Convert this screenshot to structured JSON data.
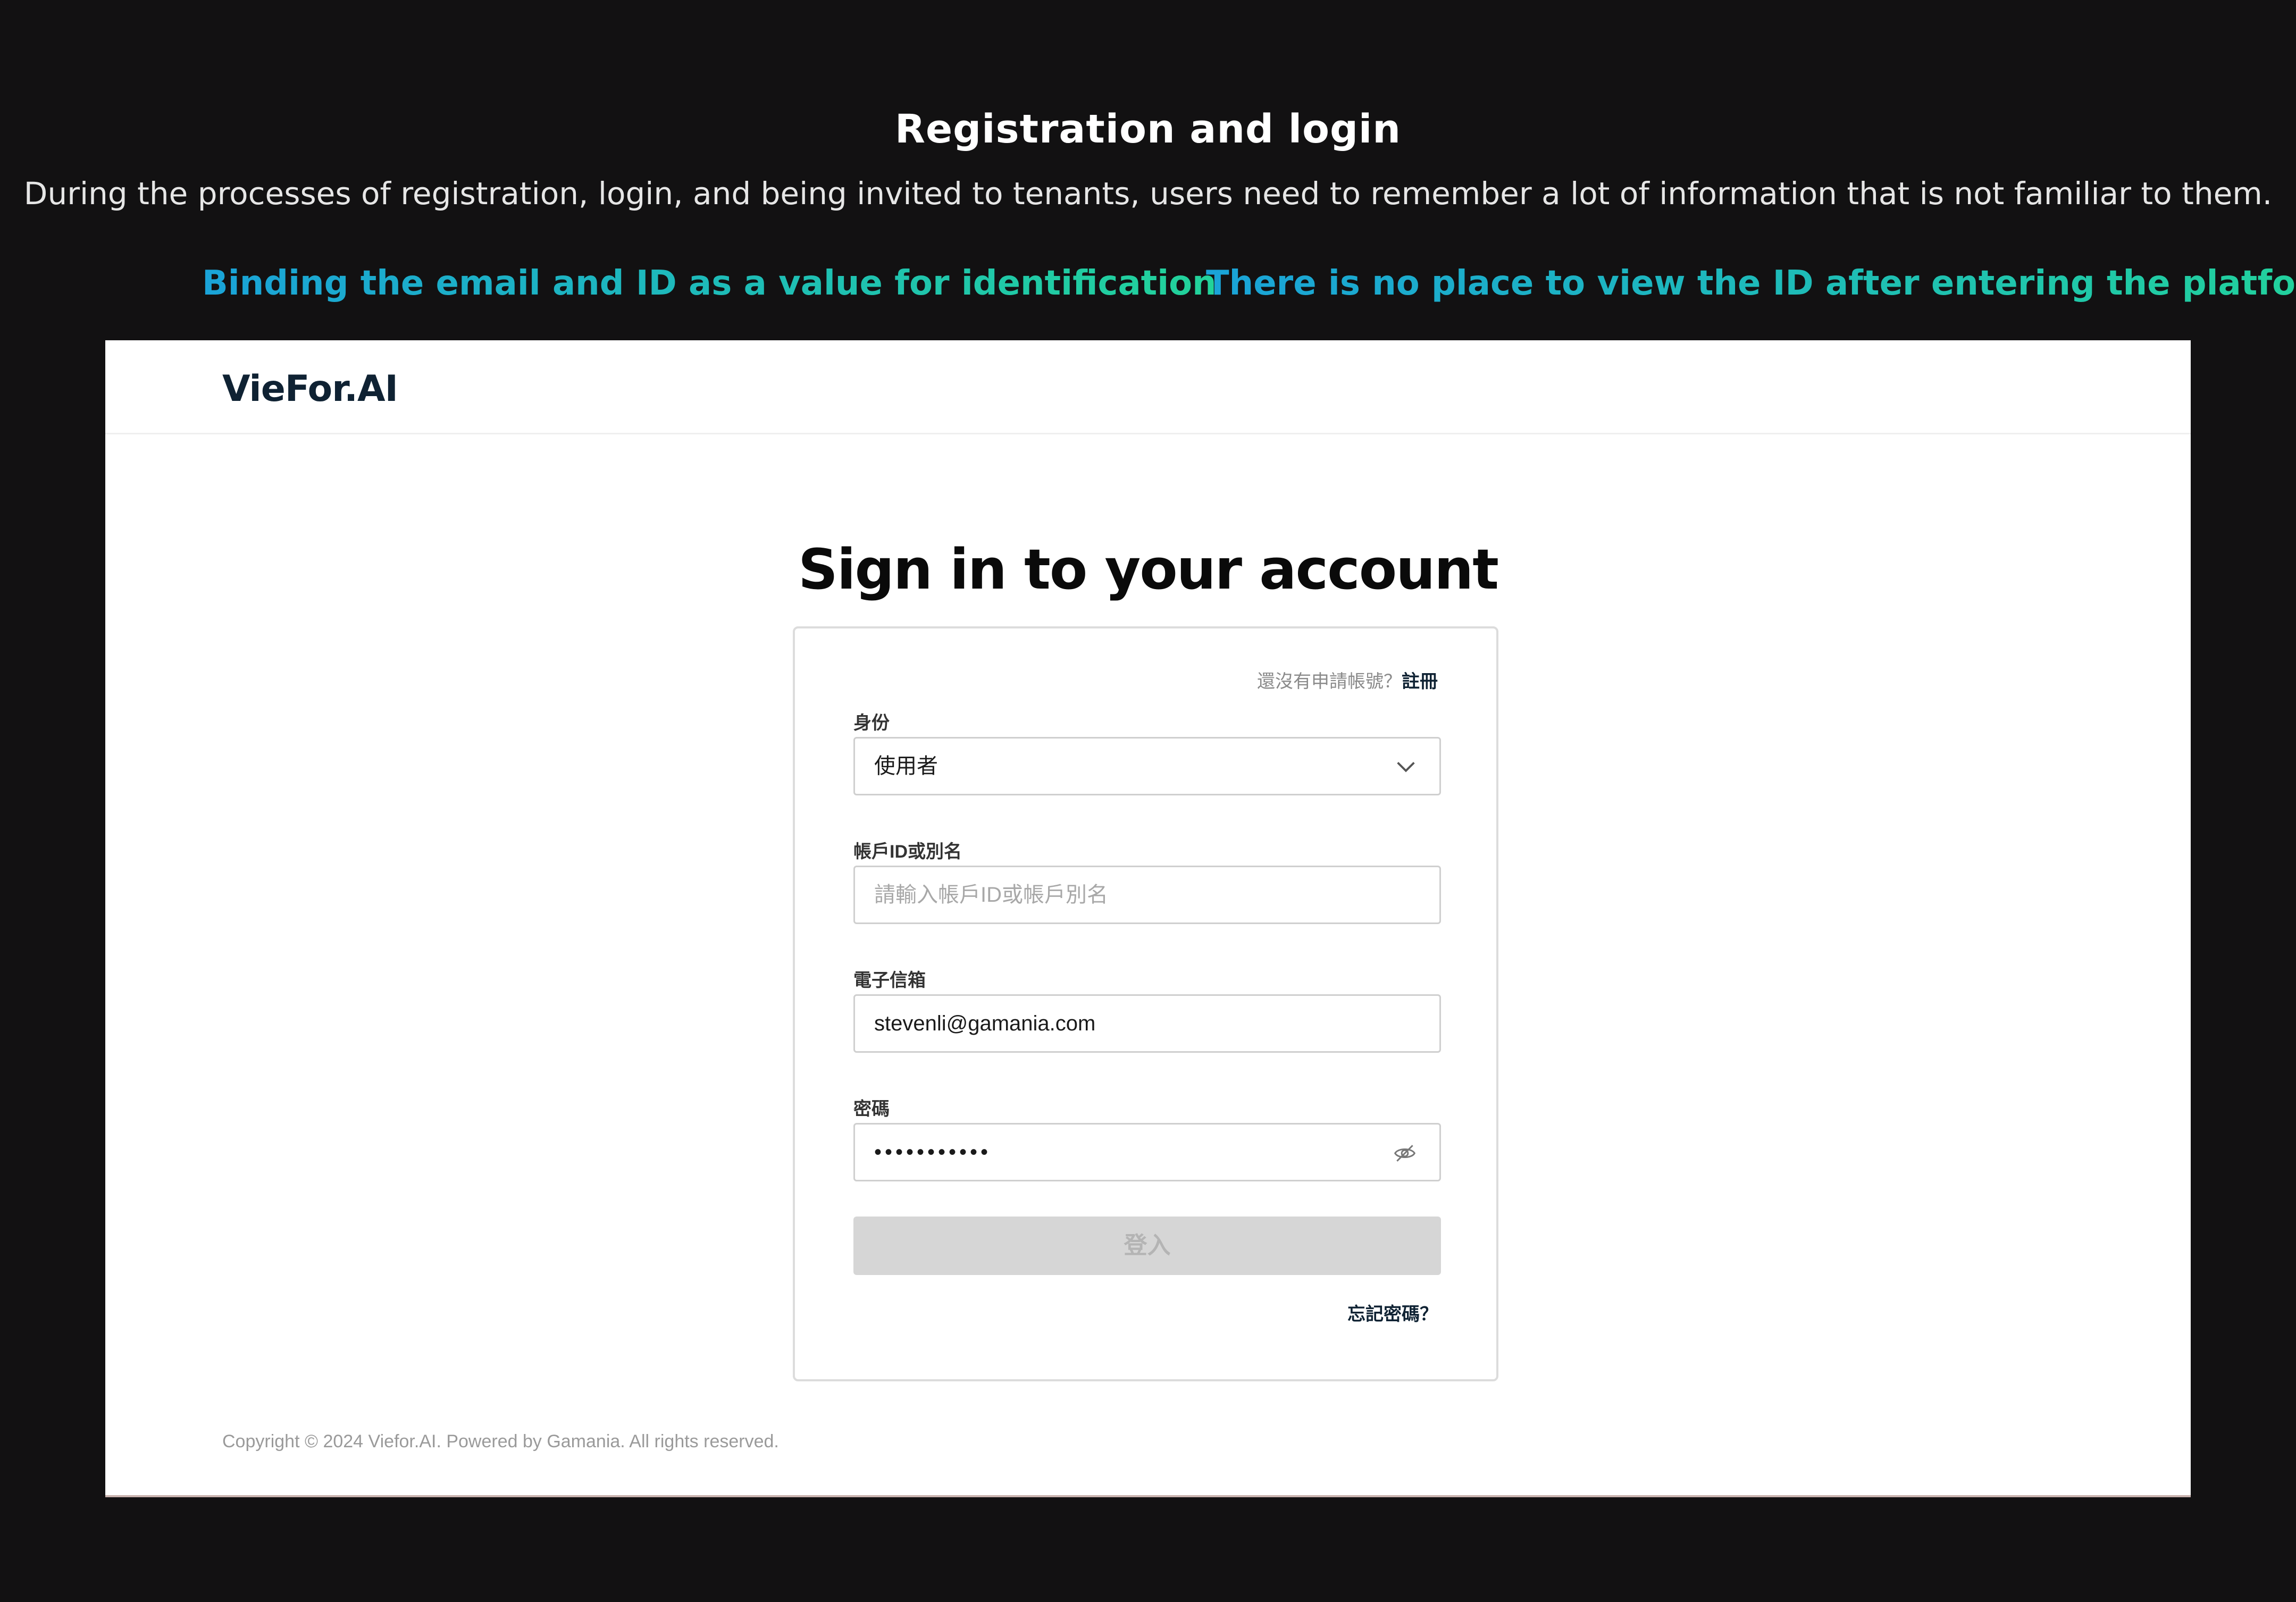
{
  "slide": {
    "title": "Registration and login",
    "subtitle": "During the processes of registration, login, and being invited to tenants, users need to remember a lot of information that is not familiar to them.",
    "callouts": [
      "Binding the email and ID as a value for identification",
      "There is no place to view the ID after entering the platform"
    ]
  },
  "app": {
    "logo": "VieFor.AI",
    "heading": "Sign in to your account",
    "register_prompt": "還沒有申請帳號？",
    "register_link": "註冊",
    "identity": {
      "label": "身份",
      "value": "使用者",
      "icon": "chevron-down-icon"
    },
    "account_id": {
      "label": "帳戶ID或別名",
      "placeholder": "請輸入帳戶ID或帳戶別名"
    },
    "email": {
      "label": "電子信箱",
      "value": "stevenli@gamania.com"
    },
    "password": {
      "label": "密碼",
      "value": "•••••••••••",
      "icon": "eye-off-icon"
    },
    "login_button": "登入",
    "forgot_password": "忘記密碼？",
    "copyright": "Copyright © 2024 Viefor.AI. Powered by Gamania. All rights reserved."
  },
  "colors": {
    "background": "#121112",
    "callout_gradient_start": "#1aa3d8",
    "callout_gradient_end": "#22d39a",
    "brand_dark": "#0f2233",
    "button_disabled": "#d6d6d6"
  }
}
